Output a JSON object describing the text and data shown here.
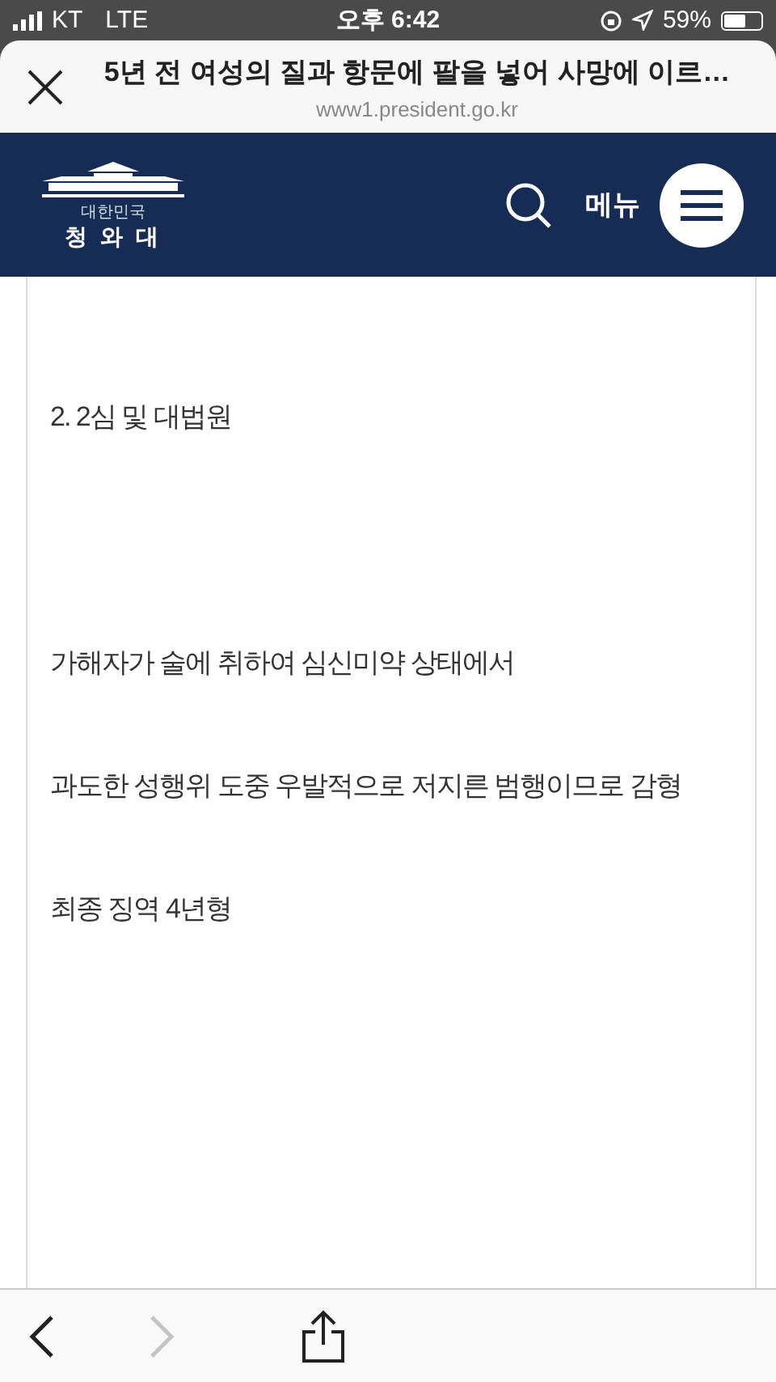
{
  "status_bar": {
    "carrier": "KT",
    "network": "LTE",
    "time": "오후 6:42",
    "battery": "59%"
  },
  "url_bar": {
    "title": "5년 전 여성의 질과 항문에 팔을 넣어 사망에 이르…",
    "domain": "www1.president.go.kr"
  },
  "header": {
    "logo_small": "대한민국",
    "logo_name": "청 와 대",
    "menu_label": "메뉴"
  },
  "article": {
    "paragraphs": [
      {
        "text": "2. 2심 및 대법원"
      },
      {
        "text": "가해자가 술에 취하여 심신미약 상태에서"
      },
      {
        "text": "과도한 성행위 도중 우발적으로 저지른 범행이므로 감형"
      },
      {
        "text": "최종 징역 4년형"
      }
    ]
  },
  "toolbar": {
    "back_disabled": false,
    "forward_disabled": true
  }
}
